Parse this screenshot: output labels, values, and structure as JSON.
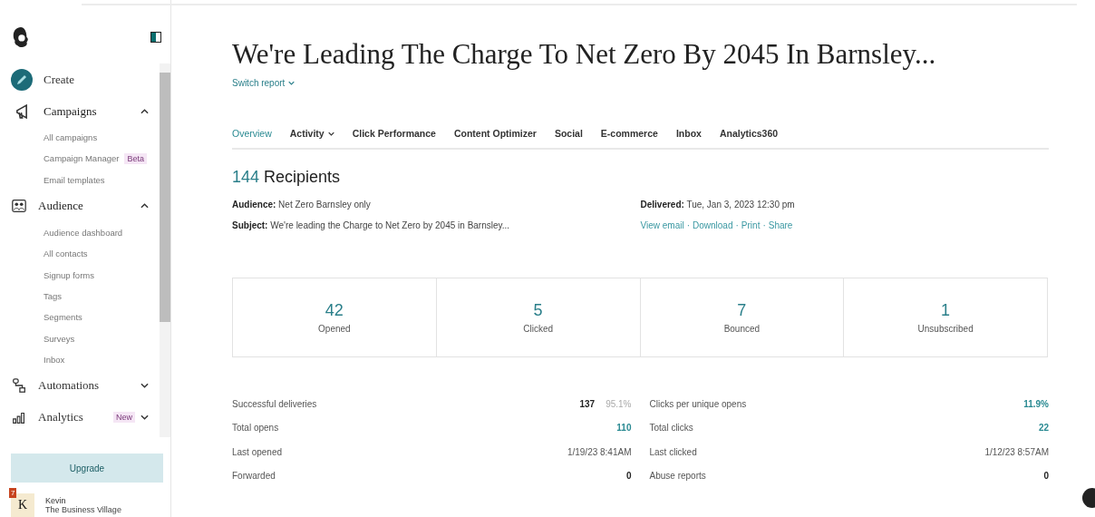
{
  "sidebar": {
    "nav": [
      {
        "label": "Create",
        "kind": "create"
      },
      {
        "label": "Campaigns",
        "kind": "campaigns",
        "expanded": true,
        "children": [
          {
            "label": "All campaigns"
          },
          {
            "label": "Campaign Manager",
            "badge": "Beta"
          },
          {
            "label": "Email templates"
          }
        ]
      },
      {
        "label": "Audience",
        "kind": "audience",
        "expanded": true,
        "children": [
          {
            "label": "Audience dashboard"
          },
          {
            "label": "All contacts"
          },
          {
            "label": "Signup forms"
          },
          {
            "label": "Tags"
          },
          {
            "label": "Segments"
          },
          {
            "label": "Surveys"
          },
          {
            "label": "Inbox"
          }
        ]
      },
      {
        "label": "Automations",
        "kind": "automations",
        "expanded": false
      },
      {
        "label": "Analytics",
        "kind": "analytics",
        "expanded": false,
        "badge": "New"
      }
    ],
    "upgrade": "Upgrade",
    "account": {
      "initial": "K",
      "notification_count": "7",
      "name": "Kevin",
      "organization": "The Business Village"
    }
  },
  "report": {
    "title": "We're Leading The Charge To Net Zero By 2045 In Barnsley...",
    "switch": "Switch report",
    "tabs": [
      {
        "label": "Overview",
        "selected": true,
        "menu": false
      },
      {
        "label": "Activity",
        "selected": false,
        "menu": true
      },
      {
        "label": "Click Performance",
        "selected": false,
        "menu": false
      },
      {
        "label": "Content Optimizer",
        "selected": false,
        "menu": false
      },
      {
        "label": "Social",
        "selected": false,
        "menu": false
      },
      {
        "label": "E-commerce",
        "selected": false,
        "menu": false
      },
      {
        "label": "Inbox",
        "selected": false,
        "menu": false
      },
      {
        "label": "Analytics360",
        "selected": false,
        "menu": false
      }
    ],
    "recipients_count": "144",
    "recipients_label": "Recipients",
    "audience": "**Audience:** Net Zero Barnsley only",
    "subject": "**Subject:** We're leading the Charge to Net Zero by 2045 in Barnsley...",
    "delivered": "**Delivered:** Tue, Jan 3, 2023 12:30 pm",
    "links": [
      "View email",
      "Download",
      "Print",
      "Share"
    ],
    "link_separator": "·",
    "stats": [
      {
        "value": "42",
        "label": "Opened"
      },
      {
        "value": "5",
        "label": "Clicked"
      },
      {
        "value": "7",
        "label": "Bounced"
      },
      {
        "value": "1",
        "label": "Unsubscribed"
      }
    ],
    "details_left": [
      {
        "label": "Successful deliveries",
        "value": "137",
        "kind": "bold",
        "percent": "95.1%"
      },
      {
        "label": "Total opens",
        "value": "110",
        "kind": "link"
      },
      {
        "label": "Last opened",
        "value": "1/19/23 8:41AM",
        "kind": "plain"
      },
      {
        "label": "Forwarded",
        "value": "0",
        "kind": "bold"
      }
    ],
    "details_right": [
      {
        "label": "Clicks per unique opens",
        "value": "11.9%",
        "kind": "link"
      },
      {
        "label": "Total clicks",
        "value": "22",
        "kind": "link"
      },
      {
        "label": "Last clicked",
        "value": "1/12/23 8:57AM",
        "kind": "plain"
      },
      {
        "label": "Abuse reports",
        "value": "0",
        "kind": "bold"
      }
    ]
  }
}
